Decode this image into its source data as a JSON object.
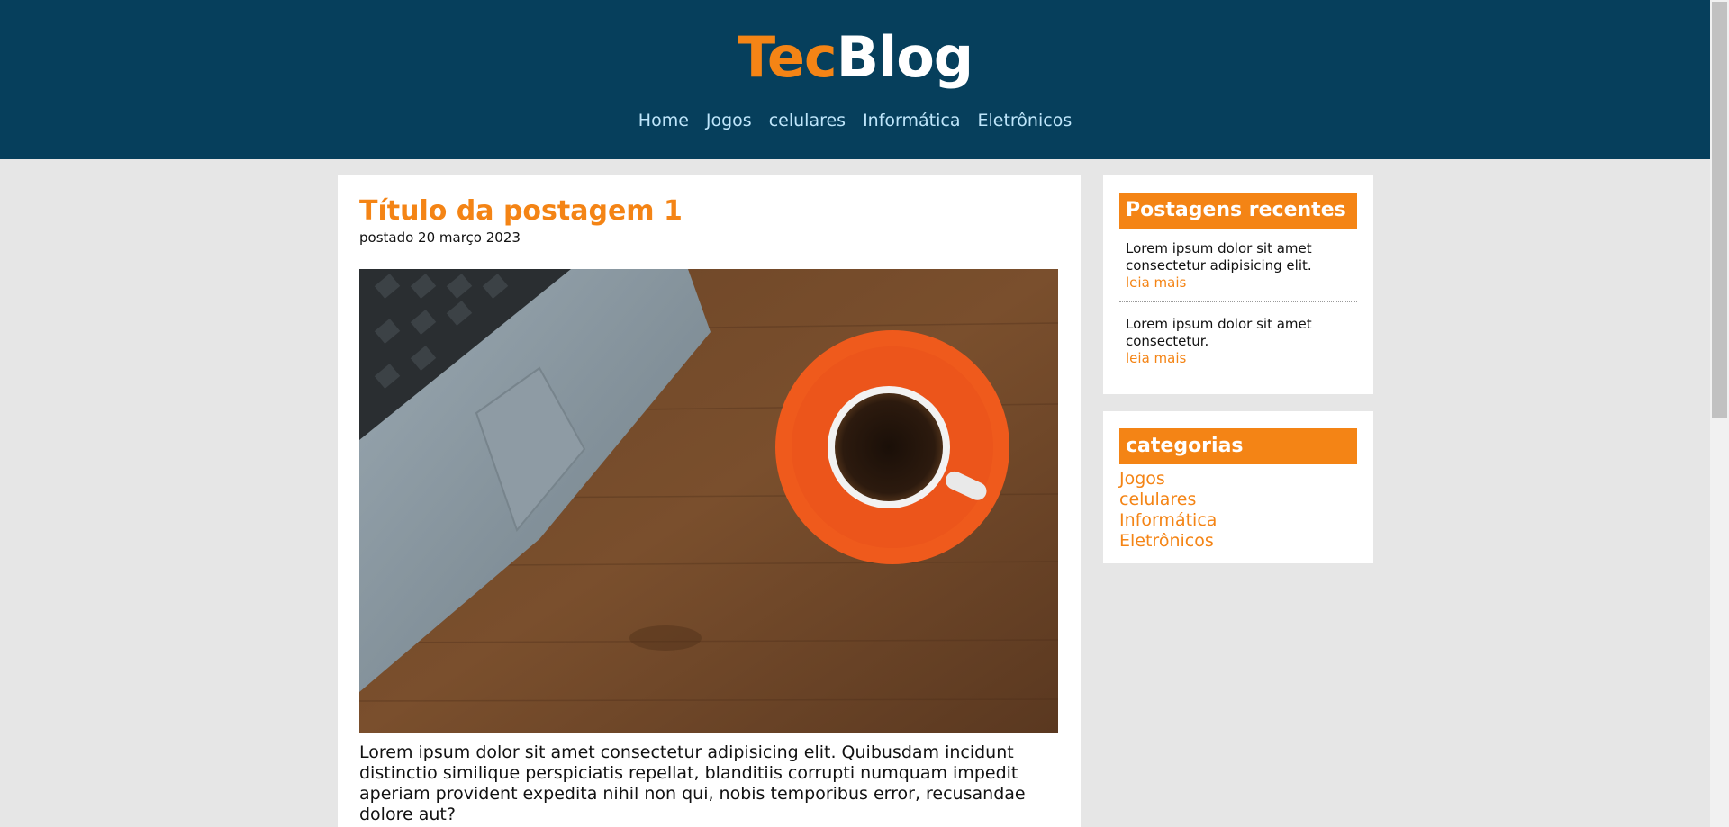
{
  "header": {
    "logo_part1": "Tec",
    "logo_part2": "Blog",
    "nav": [
      "Home",
      "Jogos",
      "celulares",
      "Informática",
      "Eletrônicos"
    ]
  },
  "post": {
    "title": "Título da postagem 1",
    "date": "postado 20 março 2023",
    "body": "Lorem ipsum dolor sit amet consectetur adipisicing elit. Quibusdam incidunt distinctio similique perspiciatis repellat, blanditiis corrupti numquam impedit aperiam provident expedita nihil non qui, nobis temporibus error, recusandae dolore aut?"
  },
  "recent": {
    "title": "Postagens recentes",
    "items": [
      {
        "text": "Lorem ipsum dolor sit amet consectetur adipisicing elit.",
        "link": "leia mais"
      },
      {
        "text": "Lorem ipsum dolor sit amet consectetur.",
        "link": "leia mais"
      }
    ]
  },
  "categories": {
    "title": "categorias",
    "items": [
      "Jogos",
      "celulares",
      "Informática",
      "Eletrônicos"
    ]
  },
  "colors": {
    "header_bg": "#063f5c",
    "accent": "#f48415",
    "nav_link": "#bfe6fb",
    "page_bg": "#e6e6e6"
  },
  "icons": {
    "post_image": "laptop-and-coffee-cup-photo"
  }
}
